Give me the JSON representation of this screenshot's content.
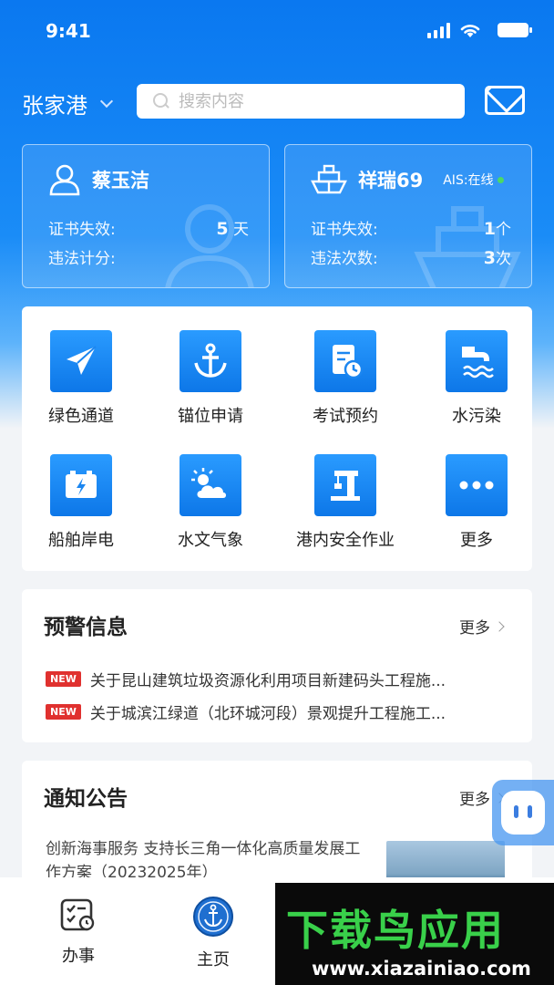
{
  "status": {
    "time": "9:41"
  },
  "header": {
    "city": "张家港",
    "search_placeholder": "搜索内容"
  },
  "person_card": {
    "name": "蔡玉洁",
    "rows": [
      {
        "label": "证书失效:",
        "value": "5",
        "unit": "天"
      },
      {
        "label": "违法计分:",
        "value": "",
        "unit": ""
      }
    ]
  },
  "ship_card": {
    "name": "祥瑞69",
    "ais": "AIS:在线",
    "rows": [
      {
        "label": "证书失效:",
        "value": "1",
        "unit": "个"
      },
      {
        "label": "违法次数:",
        "value": "3",
        "unit": "次"
      }
    ]
  },
  "services": [
    {
      "label": "绿色通道",
      "icon": "paper-plane-icon"
    },
    {
      "label": "锚位申请",
      "icon": "anchor-icon"
    },
    {
      "label": "考试预约",
      "icon": "exam-schedule-icon"
    },
    {
      "label": "水污染",
      "icon": "water-pollution-icon"
    },
    {
      "label": "船舶岸电",
      "icon": "battery-icon"
    },
    {
      "label": "水文气象",
      "icon": "weather-icon"
    },
    {
      "label": "港内安全作业",
      "icon": "crane-icon"
    },
    {
      "label": "更多",
      "icon": "more-icon"
    }
  ],
  "warnings": {
    "title": "预警信息",
    "more": "更多",
    "badge": "NEW",
    "items": [
      "关于昆山建筑垃圾资源化利用项目新建码头工程施...",
      "关于城滨江绿道（北环城河段）景观提升工程施工..."
    ]
  },
  "notices": {
    "title": "通知公告",
    "more": "更多",
    "items": [
      {
        "text": "创新海事服务 支持长三角一体化高质量发展工作方案（20232025年）"
      }
    ]
  },
  "tabbar": {
    "tabs": [
      {
        "label": "办事",
        "icon": "tasks-icon"
      },
      {
        "label": "主页",
        "icon": "maritime-emblem-icon"
      }
    ]
  },
  "ad": {
    "title": "下载鸟应用",
    "url": "www.xiazainiao.com"
  }
}
